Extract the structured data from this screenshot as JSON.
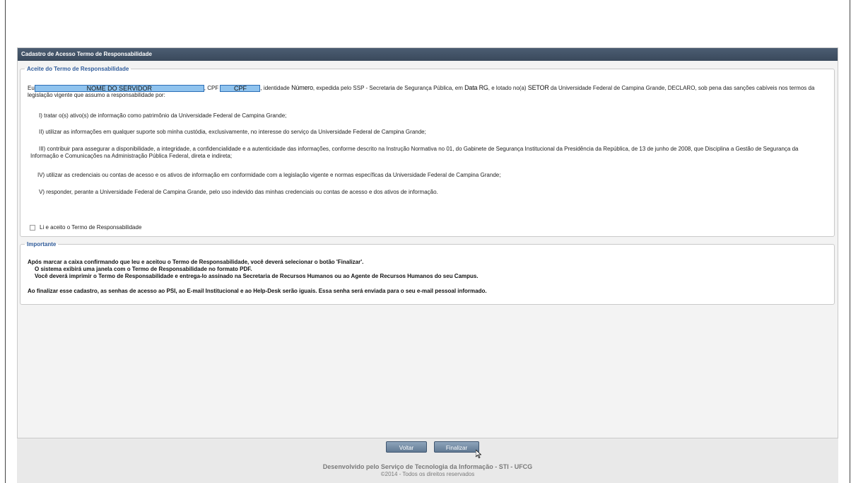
{
  "panel": {
    "title": "Cadastro de Acesso Termo de Responsabilidade"
  },
  "termo": {
    "legend": "Aceite do Termo de Responsabilidade",
    "p_eu": "Eu",
    "nome_placeholder": "NOME DO SERVIDOR",
    "cpf_label": ", CPF",
    "cpf_placeholder": "CPF",
    "identidade_label": ", identidade",
    "identidade_value": "Número",
    "expedida": ", expedida pelo SSP - Secretaria de Segurança Pública, em",
    "data_rg": "Data RG",
    "lotado": ", e lotado no(a)",
    "setor": "SETOR",
    "p_rest": " da Universidade Federal de Campina Grande, DECLARO, sob pena das sanções cabíveis nos termos da legislação vigente que assumo a responsabilidade por:",
    "item1": "I) tratar o(s) ativo(s) de informação como patrimônio da Universidade Federal de Campina Grande;",
    "item2": "II) utilizar as informações em qualquer suporte sob minha custódia, exclusivamente, no interesse do serviço da Universidade Federal de Campina Grande;",
    "item3": "III) contribuir para assegurar a disponibilidade, a integridade, a confidencialidade e a autenticidade das informações, conforme descrito na Instrução Normativa no 01, do Gabinete de Segurança Institucional da Presidência da República, de 13 de junho de 2008, que Disciplina a Gestão de Segurança da Informação e Comunicações na Administração Pública Federal, direta e indireta;",
    "item4": "IV) utilizar as credenciais ou contas de acesso e os ativos de informação em conformidade com a legislação vigente e normas específicas da Universidade Federal de Campina Grande;",
    "item5": "V) responder, perante a Universidade Federal de Campina Grande, pelo uso indevido das minhas credenciais ou contas de acesso e dos ativos de informação.",
    "checkbox_label": "Li e aceito o Termo de Responsabilidade",
    "checkbox_checked": false
  },
  "importante": {
    "legend": "Importante",
    "line1": "Após marcar a caixa confirmando que leu e aceitou o Termo de Responsabilidade, você deverá selecionar o botão 'Finalizar'.",
    "line2": "O sistema exibirá uma janela com o Termo de Responsabilidade no formato PDF.",
    "line3": "Você deverá imprimir o Termo de Responsabilidade e entrega-lo assinado na Secretaria de Recursos Humanos ou ao Agente de Recursos Humanos do seu Campus.",
    "line4": "Ao finalizar esse cadastro, as senhas de acesso ao PSI, ao E-mail Institucional e ao Help-Desk serão iguais. Essa senha será enviada para o seu e-mail pessoal informado."
  },
  "buttons": {
    "voltar": "Voltar",
    "finalizar": "Finalizar"
  },
  "footer": {
    "line1": "Desenvolvido pelo Serviço de Tecnologia da Informação - STI - UFCG",
    "line2": "©2014 - Todos os direitos reservados"
  },
  "colors": {
    "header_bg": "#3a495c",
    "legend_text": "#2f5b9a",
    "button_bg": "#627a94",
    "mask_fill": "#8fc3ee"
  }
}
